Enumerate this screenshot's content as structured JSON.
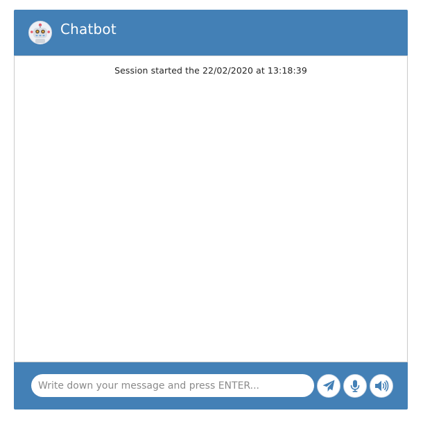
{
  "header": {
    "title": "Chatbot",
    "avatar_icon": "robot-icon"
  },
  "messages": {
    "session_note": "Session started the 22/02/2020 at 13:18:39"
  },
  "composer": {
    "placeholder": "Write down your message and press ENTER...",
    "value": "",
    "buttons": [
      {
        "name": "send",
        "icon": "paper-plane-icon"
      },
      {
        "name": "microphone",
        "icon": "microphone-icon"
      },
      {
        "name": "audio",
        "icon": "speaker-icon"
      }
    ]
  },
  "colors": {
    "brand": "#4380b6",
    "panel_background": "#ffffff",
    "icon": "#4380b6"
  }
}
